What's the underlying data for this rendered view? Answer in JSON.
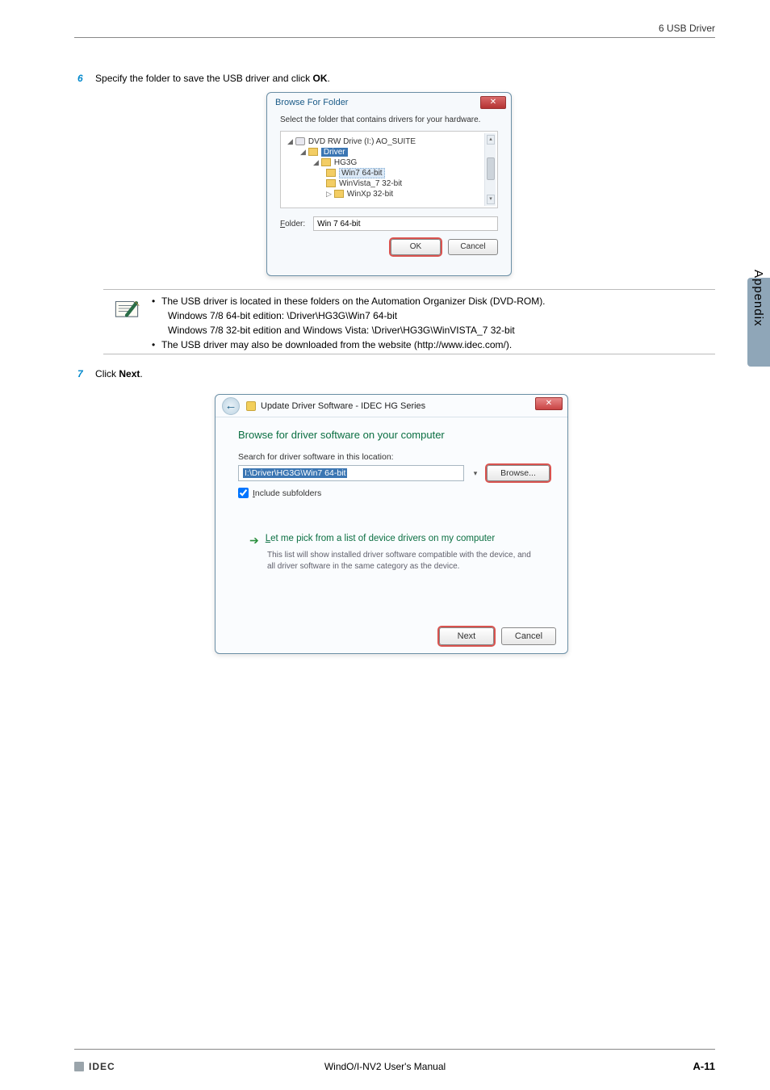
{
  "header": {
    "section": "6 USB Driver"
  },
  "steps": {
    "s6": {
      "num": "6",
      "text_a": "Specify the folder to save the USB driver and click ",
      "bold": "OK",
      "text_b": "."
    },
    "s7": {
      "num": "7",
      "text_a": "Click ",
      "bold": "Next",
      "text_b": "."
    }
  },
  "dlg1": {
    "title": "Browse For Folder",
    "close_glyph": "✕",
    "subtitle": "Select the folder that contains drivers for your hardware.",
    "tree": {
      "n0": "DVD RW Drive (I:) AO_SUITE",
      "n1": "Driver",
      "n2": "HG3G",
      "n3": "Win7 64-bit",
      "n4": "WinVista_7 32-bit",
      "n5": "WinXp 32-bit"
    },
    "folder_label": "Folder:",
    "folder_value": "Win 7 64-bit",
    "ok": "OK",
    "cancel": "Cancel"
  },
  "note": {
    "b1": "The USB driver is located in these folders on the Automation Organizer Disk (DVD-ROM).",
    "l2": "Windows 7/8 64-bit edition: \\Driver\\HG3G\\Win7 64-bit",
    "l3": "Windows 7/8 32-bit edition and Windows Vista: \\Driver\\HG3G\\WinVISTA_7 32-bit",
    "b2": "The USB driver may also be downloaded from the website (http://www.idec.com/)."
  },
  "dlg2": {
    "back_glyph": "←",
    "title": "Update Driver Software - IDEC HG Series",
    "close_glyph": "✕",
    "heading": "Browse for driver software on your computer",
    "search_label": "Search for driver software in this location:",
    "path": "I:\\Driver\\HG3G\\Win7 64-bit",
    "browse": "Browse...",
    "include": "Include subfolders",
    "opt_title": "Let me pick from a list of device drivers on my computer",
    "opt_desc": "This list will show installed driver software compatible with the device, and all driver software in the same category as the device.",
    "next": "Next",
    "cancel": "Cancel"
  },
  "side": {
    "label": "Appendix"
  },
  "footer": {
    "logo": "IDEC",
    "center": "WindO/I-NV2 User's Manual",
    "page": "A-11"
  }
}
